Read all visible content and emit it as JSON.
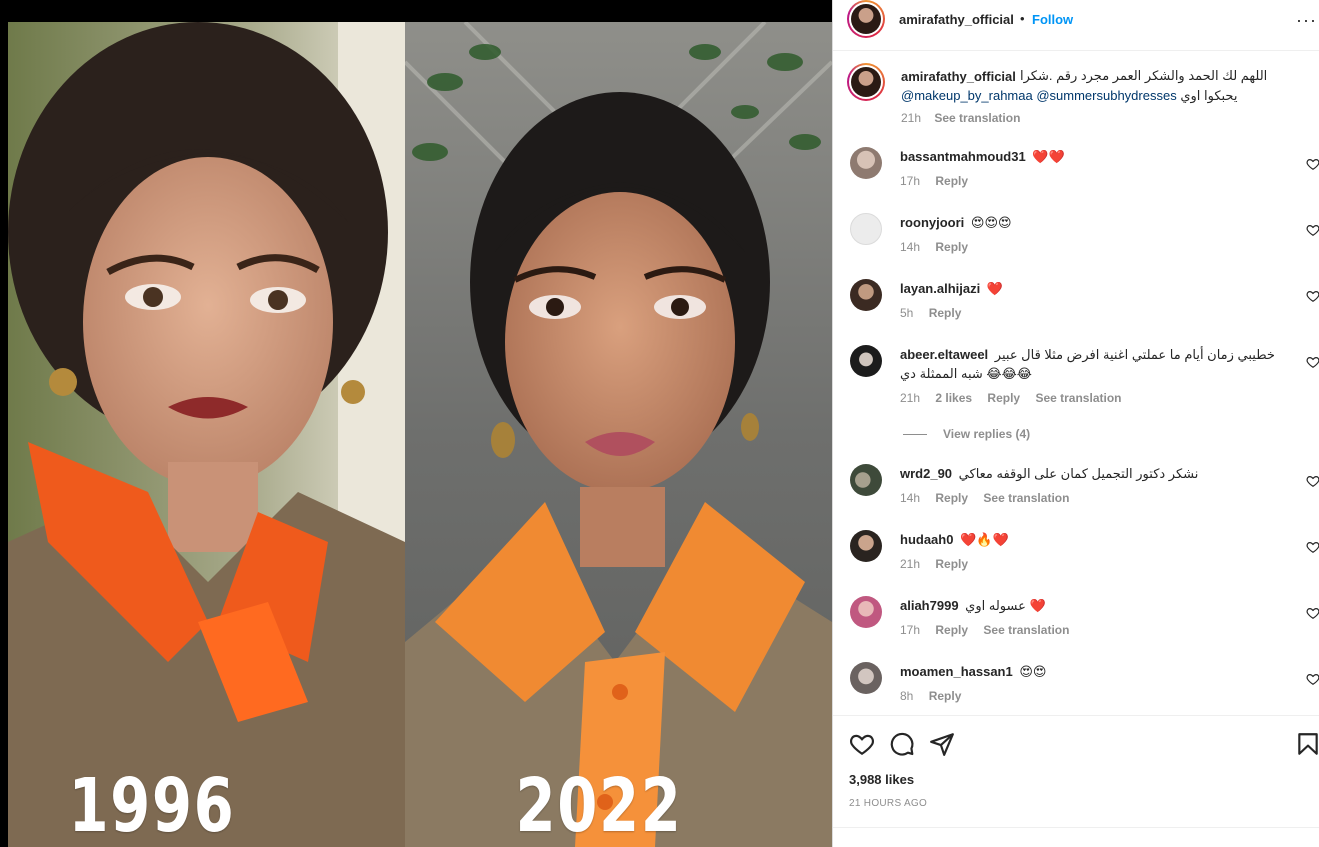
{
  "post": {
    "username": "amirafathy_official",
    "follow_label": "Follow",
    "dot": "•",
    "more_label": "···",
    "media": {
      "left_year": "1996",
      "right_year": "2022"
    }
  },
  "caption": {
    "username": "amirafathy_official",
    "text_line1": "اللهم لك الحمد والشكر العمر مجرد رقم .شكرا",
    "mention1": "@makeup_by_rahmaa",
    "mention2": "@summersubhydresses",
    "text_line2_tail": "يحبكوا اوي",
    "time": "21h",
    "see_translation": "See translation"
  },
  "comments": [
    {
      "username": "bassantmahmoud31",
      "text": "❤️❤️",
      "time": "17h",
      "reply": "Reply"
    },
    {
      "username": "roonyjoori",
      "text": "😍😍😍",
      "time": "14h",
      "reply": "Reply"
    },
    {
      "username": "layan.alhijazi",
      "text": "❤️",
      "time": "5h",
      "reply": "Reply"
    },
    {
      "username": "abeer.eltaweel",
      "text": "خطيبي زمان أيام ما عملتي اغنية افرض مثلا قال عبير",
      "text2": "شبه الممثلة دي 😂😂😂",
      "time": "21h",
      "likes": "2 likes",
      "reply": "Reply",
      "see_translation": "See translation",
      "view_replies": "View replies (4)"
    },
    {
      "username": "wrd2_90",
      "text": "نشكر دكتور التجميل كمان على الوقفه معاكي",
      "time": "14h",
      "reply": "Reply",
      "see_translation": "See translation"
    },
    {
      "username": "hudaah0",
      "text": "❤️🔥❤️",
      "time": "21h",
      "reply": "Reply"
    },
    {
      "username": "aliah7999",
      "text": "عسوله اوي ❤️",
      "time": "17h",
      "reply": "Reply",
      "see_translation": "See translation"
    },
    {
      "username": "moamen_hassan1",
      "text": "😍😍",
      "time": "8h",
      "reply": "Reply"
    }
  ],
  "footer": {
    "likes": "3,988 likes",
    "time_ago": "21 HOURS AGO"
  },
  "icons": [
    "heart-icon",
    "comment-icon",
    "share-icon",
    "bookmark-icon",
    "more-icon"
  ],
  "colors": {
    "accent": "#0095f6",
    "muted": "#8e8e8e",
    "like_red": "#ed4956"
  }
}
